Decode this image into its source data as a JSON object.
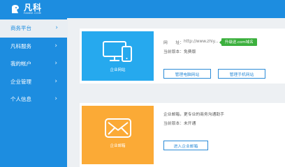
{
  "logo": {
    "name": "凡科",
    "sub": "FANKE.COM"
  },
  "sidebar": {
    "items": [
      {
        "label": "商务平台",
        "active": true
      },
      {
        "label": "凡科服务"
      },
      {
        "label": "我的帐户"
      },
      {
        "label": "企业管理"
      },
      {
        "label": "个人信息"
      }
    ],
    "chevron": "chevron-right-icon"
  },
  "website_card": {
    "tile_label": "企业网站",
    "domain_label": "网　　址：",
    "domain_value": "http://www.zhiy...",
    "upgrade_label": "升级送.com域名",
    "version_label": "当前版本：",
    "version_value": "免费版",
    "btn_pc": "管理电脑网站",
    "btn_mobile": "管理手机网站"
  },
  "mail_card": {
    "tile_label": "企业邮箱",
    "desc": "企业邮箱，更专业的商务沟通助手",
    "version_label": "当前版本：",
    "version_value": "未开通",
    "btn_enter": "进入企业邮箱"
  },
  "colors": {
    "brand_blue": "#1d8de0",
    "tile_blue": "#26a9ee",
    "tile_orange": "#fbaa36",
    "upgrade_green": "#3cb03e"
  }
}
